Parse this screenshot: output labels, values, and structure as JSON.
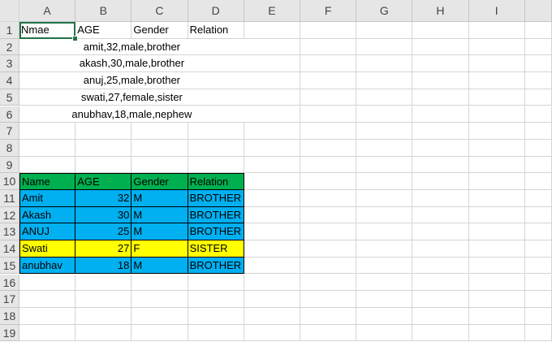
{
  "columns": [
    "A",
    "B",
    "C",
    "D",
    "E",
    "F",
    "G",
    "H",
    "I"
  ],
  "rows": [
    1,
    2,
    3,
    4,
    5,
    6,
    7,
    8,
    9,
    10,
    11,
    12,
    13,
    14,
    15,
    16,
    17,
    18,
    19
  ],
  "header_row": {
    "row": 1,
    "cells": [
      "Nmae",
      "AGE",
      "Gender",
      "Relation"
    ]
  },
  "raw_lines": [
    "amit,32,male,brother",
    "akash,30,male,brother",
    "anuj,25,male,brother",
    "swati,27,female,sister",
    "anubhav,18,male,nephew"
  ],
  "table": {
    "headers": [
      "Name",
      "AGE",
      "Gender",
      "Relation"
    ],
    "rows": [
      {
        "name": "Amit",
        "age": "32",
        "gender": "M",
        "relation": "BROTHER",
        "fill": "#00B0F0"
      },
      {
        "name": "Akash",
        "age": "30",
        "gender": "M",
        "relation": "BROTHER",
        "fill": "#00B0F0"
      },
      {
        "name": "ANUJ",
        "age": "25",
        "gender": "M",
        "relation": "BROTHER",
        "fill": "#00B0F0"
      },
      {
        "name": "Swati",
        "age": "27",
        "gender": "F",
        "relation": "SISTER",
        "fill": "#FFFF00"
      },
      {
        "name": "anubhav",
        "age": "18",
        "gender": "M",
        "relation": "BROTHER",
        "fill": "#00B0F0"
      }
    ],
    "header_fill": "#00B050"
  },
  "selected_cell": "A1"
}
